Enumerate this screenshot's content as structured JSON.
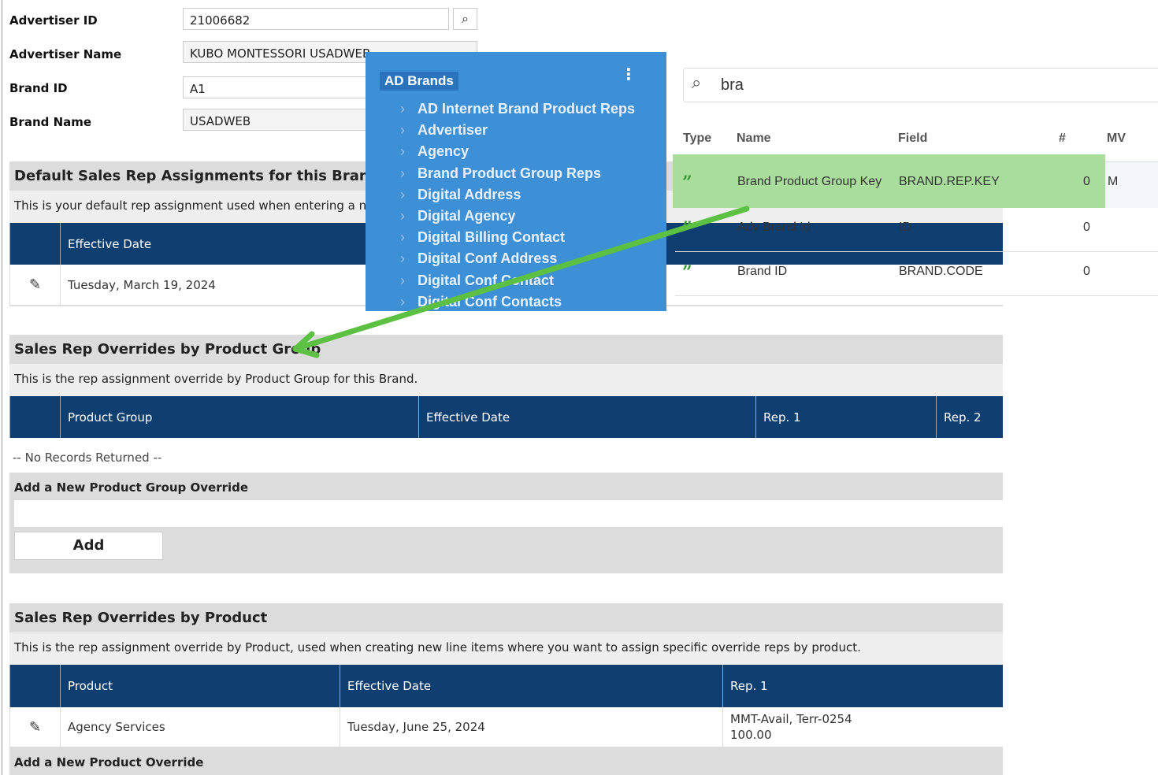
{
  "form": {
    "advertiser_id": {
      "label": "Advertiser ID",
      "value": "21006682"
    },
    "advertiser_name": {
      "label": "Advertiser Name",
      "value": "KUBO MONTESSORI USADWEB"
    },
    "brand_id": {
      "label": "Brand ID",
      "value": "A1"
    },
    "brand_name": {
      "label": "Brand Name",
      "value": "USADWEB"
    }
  },
  "default_section": {
    "title": "Default Sales Rep Assignments for this Brand",
    "desc": "This is your default rep assignment used when entering a new",
    "columns": [
      "Effective Date"
    ],
    "rows": [
      {
        "effective_date": "Tuesday, March 19, 2024"
      }
    ]
  },
  "pg_section": {
    "title": "Sales Rep Overrides by Product Group",
    "desc": "This is the rep assignment override by Product Group for this Brand.",
    "columns": [
      "Product Group",
      "Effective Date",
      "Rep. 1",
      "Rep. 2"
    ],
    "empty": "-- No Records Returned --",
    "add_title": "Add a New Product Group Override",
    "add_button": "Add"
  },
  "prod_section": {
    "title": "Sales Rep Overrides by Product",
    "desc": "This is the rep assignment override by Product, used when creating new line items where you want to assign specific override reps by product.",
    "columns": [
      "Product",
      "Effective Date",
      "Rep. 1"
    ],
    "rows": [
      {
        "product": "Agency Services",
        "effective_date": "Tuesday, June 25, 2024",
        "rep1": "MMT-Avail, Terr-0254",
        "rep1_pct": "100.00"
      }
    ],
    "add_title": "Add a New Product Override"
  },
  "brands_panel": {
    "title": "AD Brands",
    "items": [
      "AD Internet Brand Product Reps",
      "Advertiser",
      "Agency",
      "Brand Product Group Reps",
      "Digital Address",
      "Digital Agency",
      "Digital Billing Contact",
      "Digital Conf Address",
      "Digital Conf Contact",
      "Digital Conf Contacts"
    ]
  },
  "search": {
    "value": "bra",
    "icon": "search-icon"
  },
  "results": {
    "columns": [
      "Type",
      "Name",
      "Field",
      "#",
      "MV"
    ],
    "rows": [
      {
        "type": "quote-icon",
        "name": "Brand Product Group Key",
        "field": "BRAND.REP.KEY",
        "count": "0",
        "mv": "M",
        "highlighted": true
      },
      {
        "type": "quote-icon",
        "name": "Adv Brand Id",
        "field": "ID",
        "count": "0",
        "mv": ""
      },
      {
        "type": "quote-icon",
        "name": "Brand ID",
        "field": "BRAND.CODE",
        "count": "0",
        "mv": ""
      }
    ]
  },
  "colors": {
    "header_navy": "#0f3f70",
    "panel_blue": "#3d8fd6",
    "highlight_green": "#a8dd9c",
    "arrow_green": "#5cc043"
  }
}
